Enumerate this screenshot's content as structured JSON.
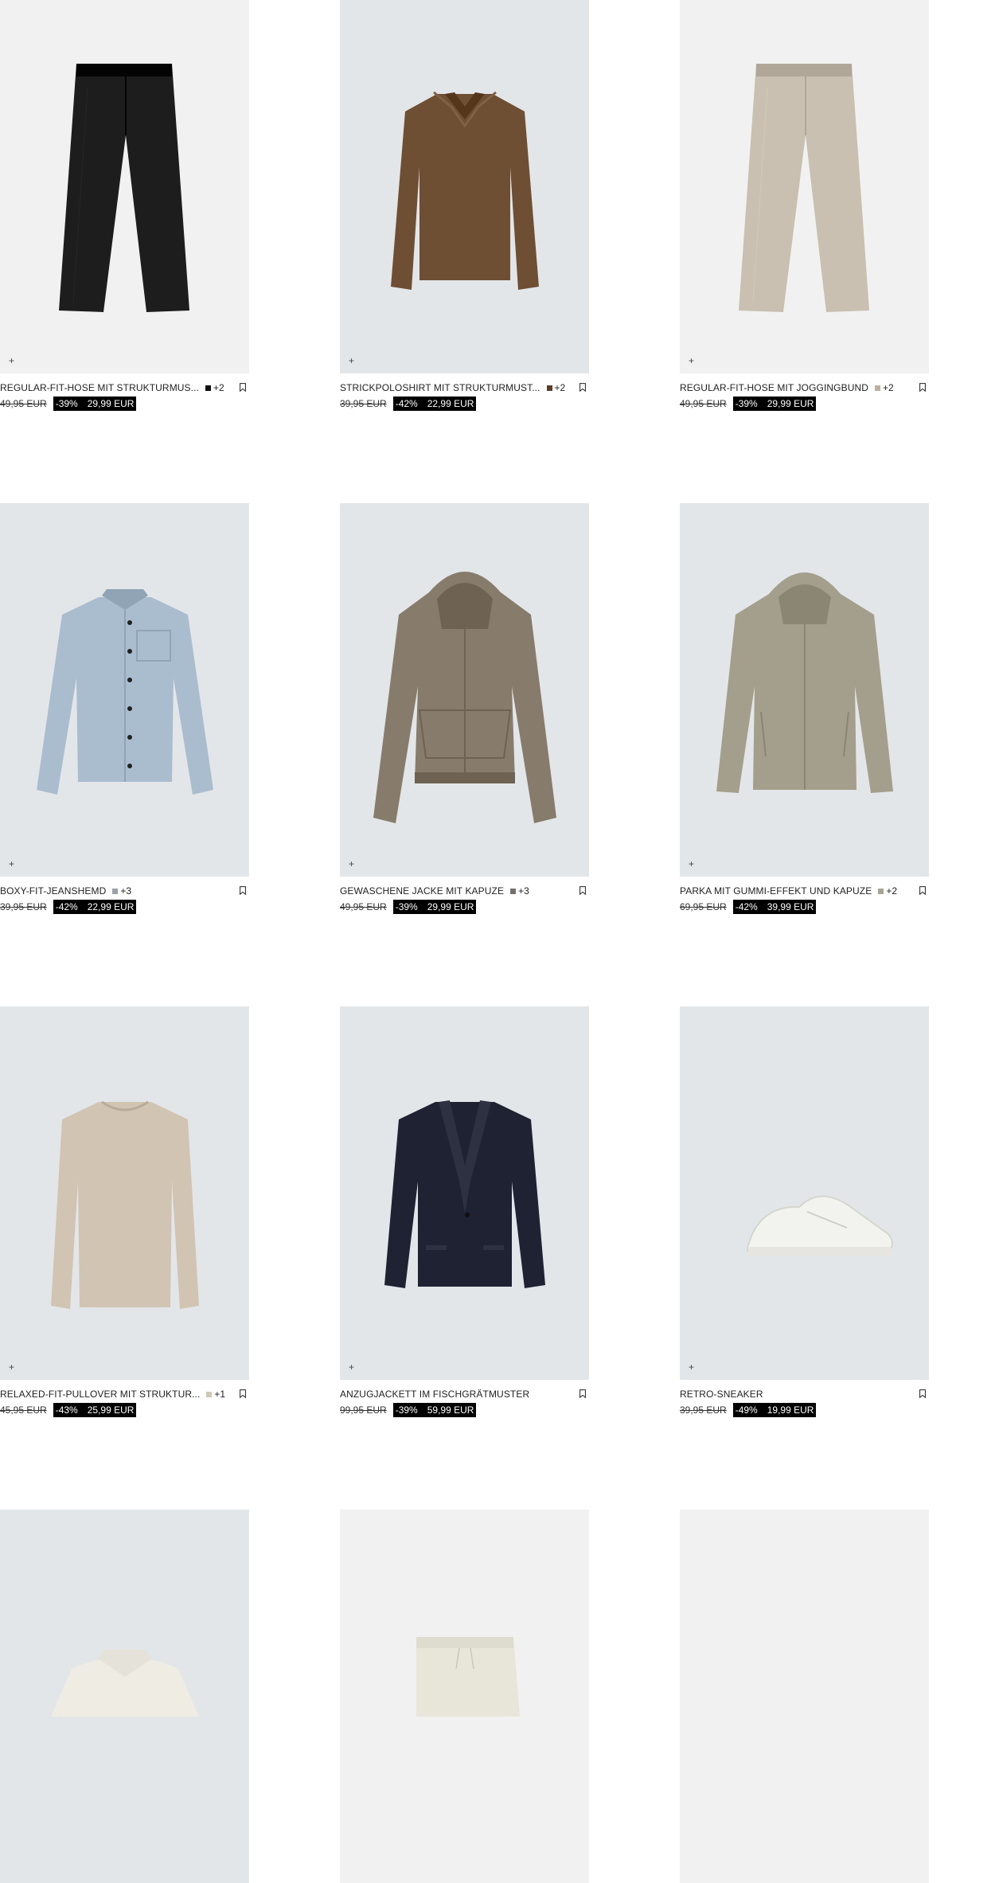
{
  "products": [
    {
      "name": "REGULAR-FIT-HOSE MIT STRUKTURMUS...",
      "swatch_color": "#111111",
      "more_colors": "+2",
      "old_price": "49,95 EUR",
      "discount": "-39%",
      "price": "29,99 EUR",
      "bg": "#f1f1f1",
      "item": "trousers",
      "item_color": "#1d1d1d"
    },
    {
      "name": "STRICKPOLOSHIRT MIT STRUKTURMUST...",
      "swatch_color": "#5b3e2a",
      "more_colors": "+2",
      "old_price": "39,95 EUR",
      "discount": "-42%",
      "price": "22,99 EUR",
      "bg": "#e3e6e8",
      "item": "polo",
      "item_color": "#6e4f33"
    },
    {
      "name": "REGULAR-FIT-HOSE MIT JOGGINGBUND",
      "swatch_color": "#b9b2a3",
      "more_colors": "+2",
      "old_price": "49,95 EUR",
      "discount": "-39%",
      "price": "29,99 EUR",
      "bg": "#f1f1f1",
      "item": "trousers",
      "item_color": "#c9c0b1"
    },
    {
      "name": "BOXY-FIT-JEANSHEMD",
      "swatch_color": "#9aa3aa",
      "more_colors": "+3",
      "old_price": "39,95 EUR",
      "discount": "-42%",
      "price": "22,99 EUR",
      "bg": "#e3e6e8",
      "item": "shirt",
      "item_color": "#a9bdcf"
    },
    {
      "name": "GEWASCHENE JACKE MIT KAPUZE",
      "swatch_color": "#77706a",
      "more_colors": "+3",
      "old_price": "49,95 EUR",
      "discount": "-39%",
      "price": "29,99 EUR",
      "bg": "#e3e6e8",
      "item": "hoodie",
      "item_color": "#877b6c"
    },
    {
      "name": "PARKA MIT GUMMI-EFFEKT UND KAPUZE",
      "swatch_color": "#a9a393",
      "more_colors": "+2",
      "old_price": "69,95 EUR",
      "discount": "-42%",
      "price": "39,99 EUR",
      "bg": "#e3e6e8",
      "item": "parka",
      "item_color": "#a49e8c"
    },
    {
      "name": "RELAXED-FIT-PULLOVER MIT STRUKTUR...",
      "swatch_color": "#cfc8b7",
      "more_colors": "+1",
      "old_price": "45,95 EUR",
      "discount": "-43%",
      "price": "25,99 EUR",
      "bg": "#e3e6e8",
      "item": "sweater",
      "item_color": "#d2c4b3"
    },
    {
      "name": "ANZUGJACKETT IM FISCHGRÄTMUSTER",
      "swatch_color": "",
      "more_colors": "",
      "old_price": "99,95 EUR",
      "discount": "-39%",
      "price": "59,99 EUR",
      "bg": "#e3e6e8",
      "item": "blazer",
      "item_color": "#1e2233"
    },
    {
      "name": "RETRO-SNEAKER",
      "swatch_color": "",
      "more_colors": "",
      "old_price": "39,95 EUR",
      "discount": "-49%",
      "price": "19,99 EUR",
      "bg": "#e3e6e8",
      "item": "sneaker",
      "item_color": "#f2f2ef"
    },
    {
      "name": "",
      "bg": "#e3e6e8",
      "item": "collar",
      "item_color": "#efece4"
    },
    {
      "name": "",
      "bg": "#f1f1f1",
      "item": "shorts",
      "item_color": "#e8e5d9"
    },
    {
      "name": "",
      "bg": "#f1f1f1",
      "item": "none",
      "item_color": ""
    }
  ],
  "icons": {
    "add": "plus-icon",
    "save": "bookmark-icon"
  },
  "plus_glyph": "+"
}
